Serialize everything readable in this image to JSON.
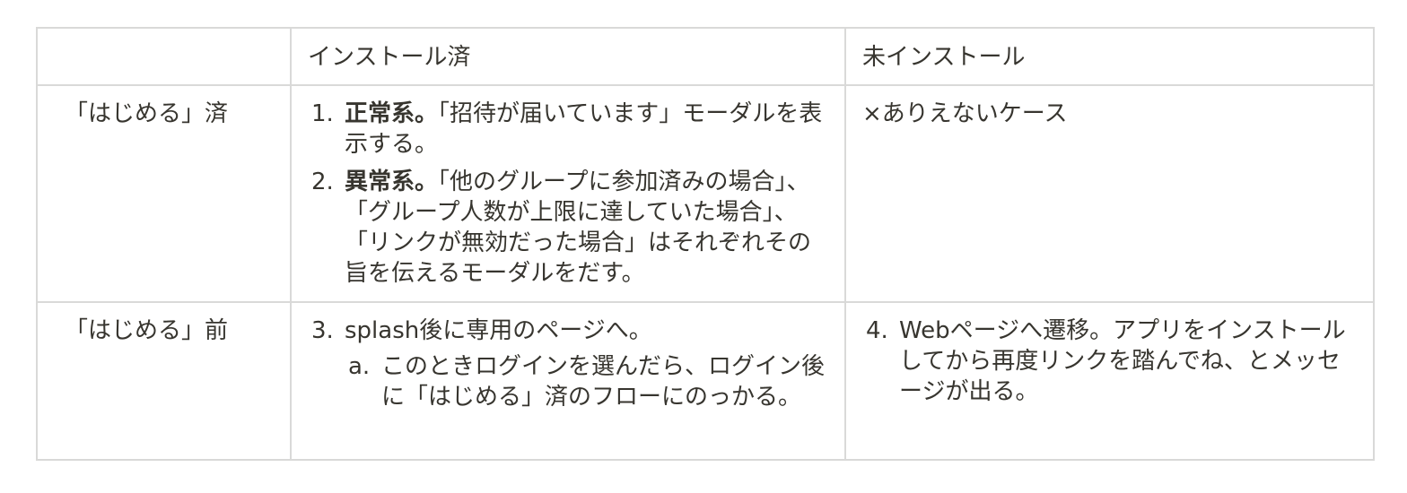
{
  "header": {
    "corner": "",
    "installed": "インストール済",
    "not_installed": "未インストール"
  },
  "rows": [
    {
      "label": "「はじめる」済",
      "installed_items": [
        {
          "num": "1.",
          "bold": "正常系。",
          "text": "「招待が届いています」モーダルを表示する。"
        },
        {
          "num": "2.",
          "bold": "異常系。",
          "text": "「他のグループに参加済みの場合」、「グループ人数が上限に達していた場合」、「リンクが無効だった場合」はそれぞれその旨を伝えるモーダルをだす。"
        }
      ],
      "not_installed_text": "×ありえないケース"
    },
    {
      "label": "「はじめる」前",
      "installed_items": [
        {
          "num": "3.",
          "text": "splash後に専用のページへ。",
          "sub": [
            {
              "num": "a.",
              "text": "このときログインを選んだら、ログイン後に「はじめる」済のフローにのっかる。"
            }
          ]
        }
      ],
      "not_installed_items": [
        {
          "num": "4.",
          "text": "Webページへ遷移。アプリをインストールしてから再度リンクを踏んでね、とメッセージが出る。"
        }
      ]
    }
  ]
}
